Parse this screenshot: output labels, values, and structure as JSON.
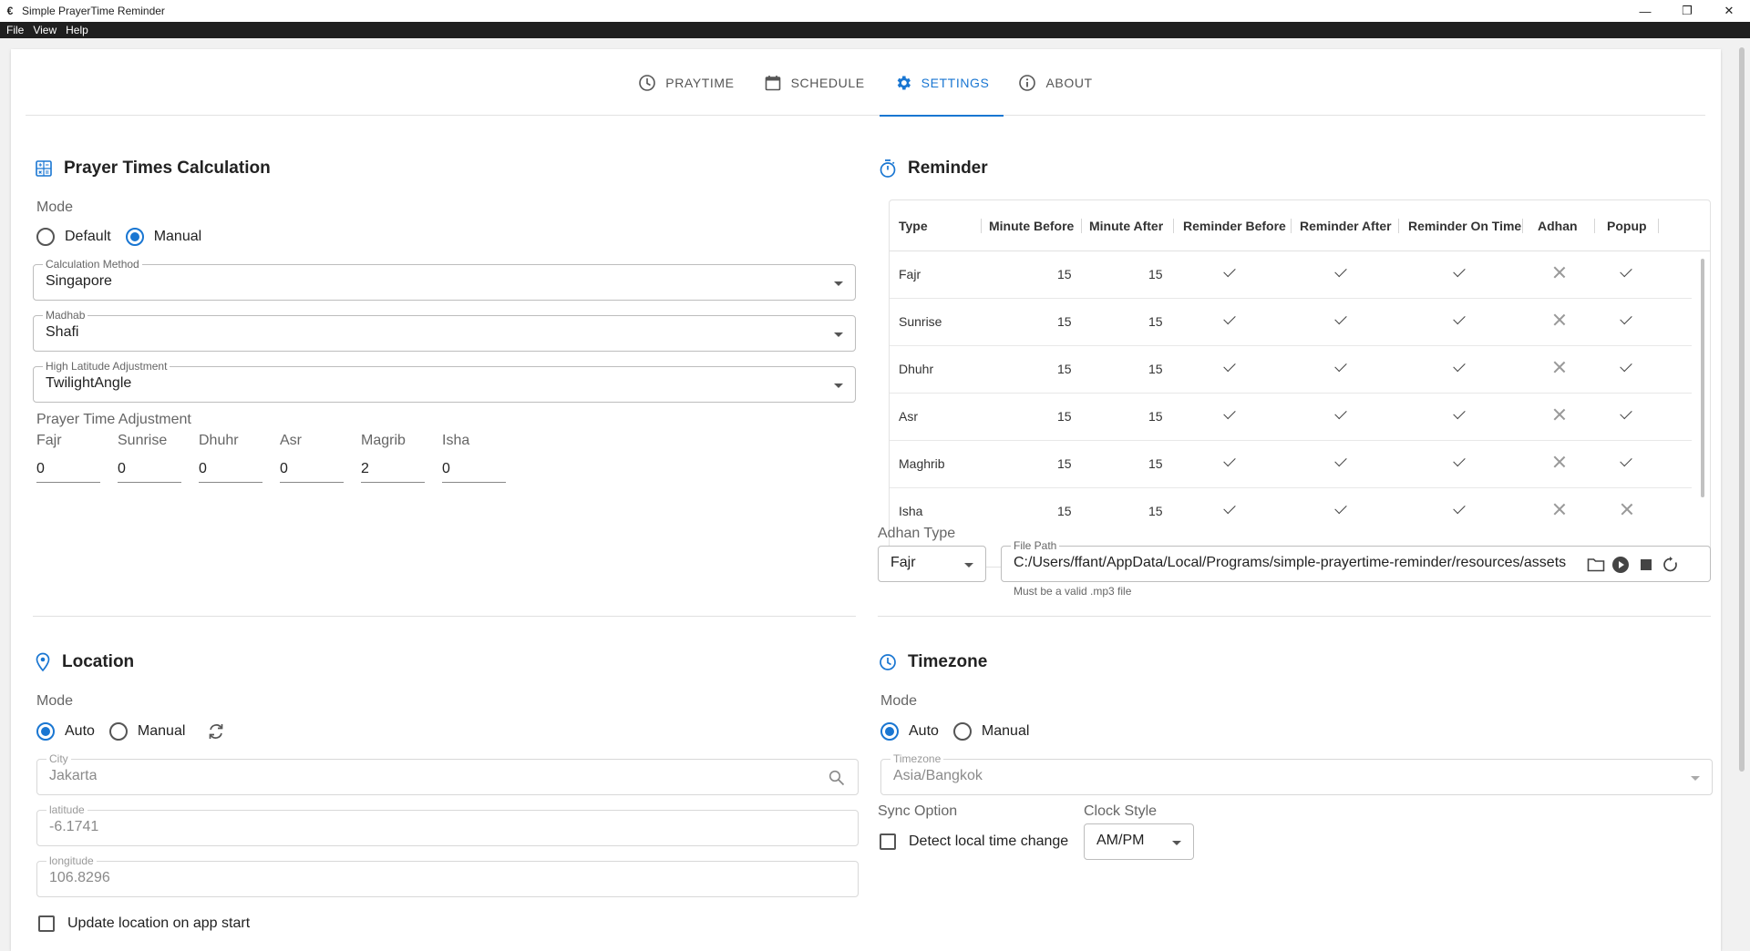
{
  "window": {
    "title": "Simple PrayerTime Reminder",
    "app_icon": "€",
    "minimize": "—",
    "restore": "❐",
    "close": "✕"
  },
  "menu": [
    "File",
    "View",
    "Help"
  ],
  "tabs": [
    {
      "label": "PRAYTIME",
      "icon": "clock-icon"
    },
    {
      "label": "SCHEDULE",
      "icon": "calendar-icon"
    },
    {
      "label": "SETTINGS",
      "icon": "gear-icon",
      "active": true
    },
    {
      "label": "ABOUT",
      "icon": "info-icon"
    }
  ],
  "accent_color": "#1976d2",
  "calc": {
    "title": "Prayer Times Calculation",
    "mode_label": "Mode",
    "mode_options": [
      "Default",
      "Manual"
    ],
    "mode_selected": "Manual",
    "method_label": "Calculation Method",
    "method_value": "Singapore",
    "madhab_label": "Madhab",
    "madhab_value": "Shafi",
    "highlat_label": "High Latitude Adjustment",
    "highlat_value": "TwilightAngle",
    "adjust_title": "Prayer Time Adjustment",
    "adjustments": [
      {
        "name": "Fajr",
        "value": "0"
      },
      {
        "name": "Sunrise",
        "value": "0"
      },
      {
        "name": "Dhuhr",
        "value": "0"
      },
      {
        "name": "Asr",
        "value": "0"
      },
      {
        "name": "Magrib",
        "value": "2"
      },
      {
        "name": "Isha",
        "value": "0"
      }
    ]
  },
  "reminder": {
    "title": "Reminder",
    "columns": [
      "Type",
      "Minute Before",
      "Minute After",
      "Reminder Before",
      "Reminder After",
      "Reminder On Time",
      "Adhan",
      "Popup"
    ],
    "rows": [
      {
        "type": "Fajr",
        "minute_before": "15",
        "minute_after": "15",
        "reminder_before": true,
        "reminder_after": true,
        "reminder_on_time": true,
        "adhan": false,
        "popup": true
      },
      {
        "type": "Sunrise",
        "minute_before": "15",
        "minute_after": "15",
        "reminder_before": true,
        "reminder_after": true,
        "reminder_on_time": true,
        "adhan": false,
        "popup": true
      },
      {
        "type": "Dhuhr",
        "minute_before": "15",
        "minute_after": "15",
        "reminder_before": true,
        "reminder_after": true,
        "reminder_on_time": true,
        "adhan": false,
        "popup": true
      },
      {
        "type": "Asr",
        "minute_before": "15",
        "minute_after": "15",
        "reminder_before": true,
        "reminder_after": true,
        "reminder_on_time": true,
        "adhan": false,
        "popup": true
      },
      {
        "type": "Maghrib",
        "minute_before": "15",
        "minute_after": "15",
        "reminder_before": true,
        "reminder_after": true,
        "reminder_on_time": true,
        "adhan": false,
        "popup": true
      },
      {
        "type": "Isha",
        "minute_before": "15",
        "minute_after": "15",
        "reminder_before": true,
        "reminder_after": true,
        "reminder_on_time": true,
        "adhan": false,
        "popup": false
      }
    ],
    "adhan_type_label": "Adhan Type",
    "adhan_type_value": "Fajr",
    "file_path_label": "File Path",
    "file_path_value": "C:/Users/ffant/AppData/Local/Programs/simple-prayertime-reminder/resources/assets",
    "file_path_hint": "Must be a valid .mp3 file"
  },
  "location": {
    "title": "Location",
    "mode_label": "Mode",
    "mode_options": [
      "Auto",
      "Manual"
    ],
    "mode_selected": "Auto",
    "city_label": "City",
    "city_value": "Jakarta",
    "lat_label": "latitude",
    "lat_value": "-6.1741",
    "lon_label": "longitude",
    "lon_value": "106.8296",
    "update_on_start_label": "Update location on app start",
    "update_on_start_checked": false
  },
  "timezone": {
    "title": "Timezone",
    "mode_label": "Mode",
    "mode_options": [
      "Auto",
      "Manual"
    ],
    "mode_selected": "Auto",
    "tz_label": "Timezone",
    "tz_value": "Asia/Bangkok",
    "sync_label": "Sync Option",
    "detect_label": "Detect local time change",
    "detect_checked": false,
    "clock_style_label": "Clock Style",
    "clock_style_value": "AM/PM"
  }
}
